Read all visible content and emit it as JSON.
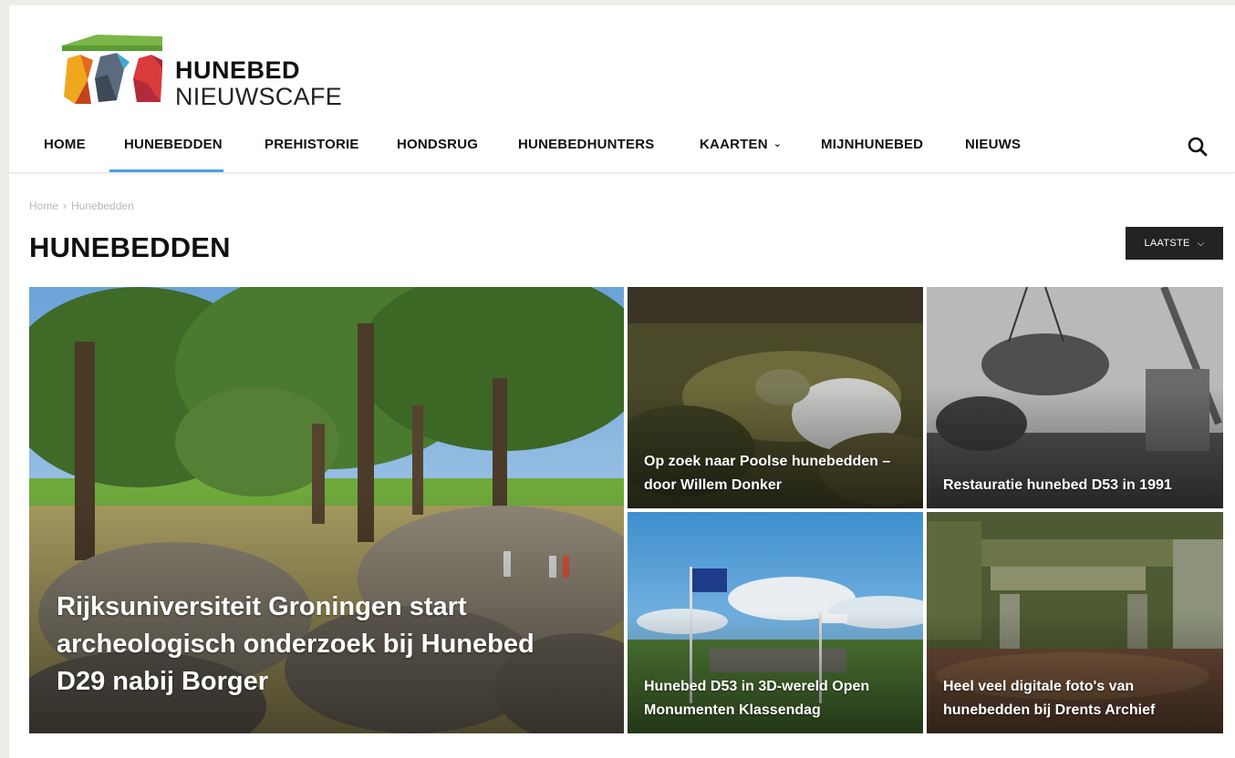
{
  "site": {
    "logo_line1": "HUNEBED",
    "logo_line2": "NIEUWSCAFE"
  },
  "nav": {
    "items": [
      {
        "label": "HOME"
      },
      {
        "label": "HUNEBEDDEN",
        "active": true
      },
      {
        "label": "PREHISTORIE"
      },
      {
        "label": "HONDSRUG"
      },
      {
        "label": "HUNEBEDHUNTERS"
      },
      {
        "label": "KAARTEN",
        "has_dropdown": true
      },
      {
        "label": "MIJNHUNEBED"
      },
      {
        "label": "NIEUWS"
      }
    ],
    "search_icon": "search-icon",
    "active_color": "#4aa3df"
  },
  "breadcrumb": {
    "home": "Home",
    "current": "Hunebedden"
  },
  "page_title": "HUNEBEDDEN",
  "sort": {
    "label": "LAATSTE"
  },
  "articles": [
    {
      "title": "Rijksuniversiteit Groningen start archeologisch onderzoek bij Hunebed D29 nabij Borger"
    },
    {
      "title": "Op zoek naar Poolse hunebedden – door Willem Donker"
    },
    {
      "title": "Restauratie hunebed D53 in 1991"
    },
    {
      "title": "Hunebed D53 in 3D-wereld Open Monumenten Klassendag"
    },
    {
      "title": "Heel veel digitale foto's van hunebedden bij Drents Archief"
    }
  ]
}
